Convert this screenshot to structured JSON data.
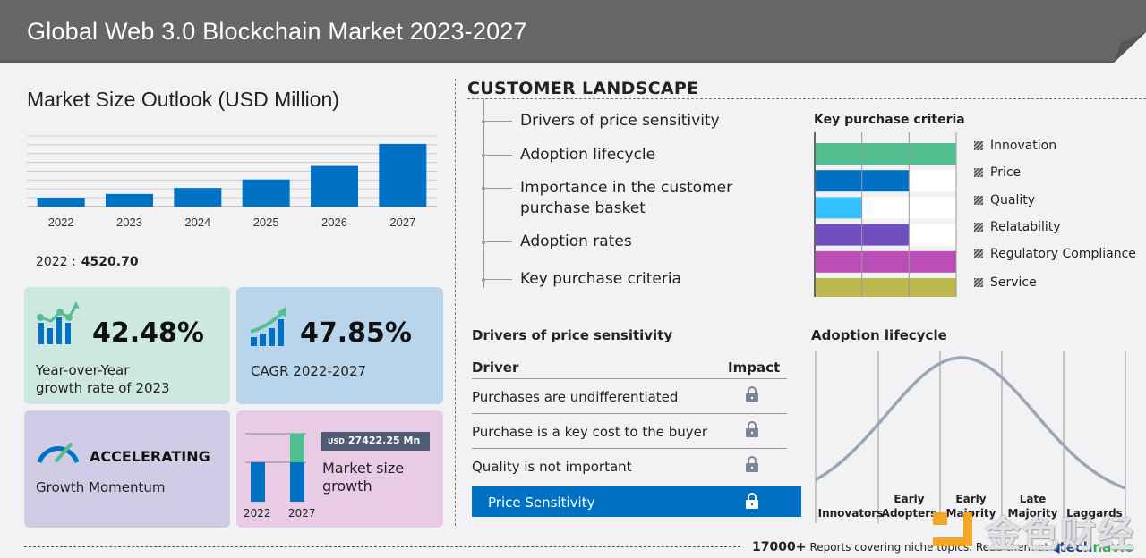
{
  "header": {
    "title": "Global Web 3.0 Blockchain Market 2023-2027"
  },
  "market_outlook": {
    "title": "Market Size Outlook (USD Million)",
    "base_year_label": "2022 :",
    "base_year_value": "4520.70"
  },
  "chart_data": [
    {
      "type": "bar",
      "title": "Market Size Outlook (USD Million)",
      "categories": [
        "2022",
        "2023",
        "2024",
        "2025",
        "2026",
        "2027"
      ],
      "values": [
        4520.7,
        6441,
        9500,
        13800,
        20700,
        31943
      ],
      "xlabel": "",
      "ylabel": "USD Million",
      "ylim": [
        0,
        36000
      ],
      "grid": true,
      "color": "#0071c5"
    },
    {
      "type": "bar",
      "orientation": "horizontal",
      "title": "Key purchase criteria",
      "categories": [
        "Innovation",
        "Price",
        "Quality",
        "Relatability",
        "Regulatory Compliance",
        "Service"
      ],
      "values": [
        3,
        2,
        1,
        2,
        3,
        3
      ],
      "xlim": [
        0,
        3
      ],
      "grid": true,
      "colors": [
        "#52bf90",
        "#0071c5",
        "#33c4ff",
        "#6f4fbf",
        "#bc4fb7",
        "#bfb84f"
      ],
      "legend": "right"
    },
    {
      "type": "line",
      "title": "Adoption lifecycle",
      "categories": [
        "Innovators",
        "Early Adopters",
        "Early Majority",
        "Late Majority",
        "Laggards"
      ],
      "shape": "bell-curve",
      "color": "#9aa6b8"
    }
  ],
  "kpis": {
    "yoy": {
      "value": "42.48%",
      "label_line1": "Year-over-Year",
      "label_line2": "growth rate of 2023",
      "icon": "growth-chart-icon"
    },
    "cagr": {
      "value": "47.85%",
      "label": "CAGR 2022-2027",
      "icon": "rising-bars-icon"
    },
    "momentum": {
      "value": "ACCELERATING",
      "label": "Growth Momentum",
      "icon": "speedometer-icon"
    },
    "market_growth": {
      "currency": "USD",
      "amount": "27422.25 Mn",
      "label_line1": "Market size",
      "label_line2": "growth",
      "years": [
        "2022",
        "2027"
      ]
    }
  },
  "customer_landscape": {
    "title": "CUSTOMER  LANDSCAPE",
    "items": [
      {
        "label": "Drivers of price sensitivity"
      },
      {
        "label": "Adoption lifecycle"
      },
      {
        "label": "Importance in the customer",
        "label2": "purchase basket"
      },
      {
        "label": "Adoption rates"
      },
      {
        "label": "Key purchase criteria"
      }
    ]
  },
  "key_purchase_criteria": {
    "title": "Key purchase criteria",
    "legend": [
      "Innovation",
      "Price",
      "Quality",
      "Relatability",
      "Regulatory Compliance",
      "Service"
    ]
  },
  "price_sensitivity": {
    "title": "Drivers of price sensitivity",
    "col_driver": "Driver",
    "col_impact": "Impact",
    "rows": [
      {
        "driver": "Purchases are undifferentiated",
        "impact_icon": "lock-icon"
      },
      {
        "driver": "Purchase is a key cost to the buyer",
        "impact_icon": "lock-icon"
      },
      {
        "driver": "Quality is not important",
        "impact_icon": "lock-icon"
      }
    ],
    "summary": {
      "label": "Price Sensitivity",
      "impact_icon": "lock-icon"
    }
  },
  "adoption_lifecycle": {
    "title": "Adoption lifecycle",
    "stages": [
      {
        "line1": "",
        "line2": "Innovators"
      },
      {
        "line1": "Early",
        "line2": "Adopters"
      },
      {
        "line1": "Early",
        "line2": "Majority"
      },
      {
        "line1": "Late",
        "line2": "Majority"
      },
      {
        "line1": "",
        "line2": "Laggards"
      }
    ]
  },
  "footer": {
    "count": "17000+",
    "text": "Reports covering niche topics. Read them at",
    "brand_part1": "tech",
    "brand_part2": "navio"
  },
  "watermark": {
    "text": "金色财经"
  },
  "colors": {
    "header_bg": "#666666",
    "accent_blue": "#0071c5",
    "accent_green": "#52bf90",
    "badge_bg": "#4e5d73"
  }
}
